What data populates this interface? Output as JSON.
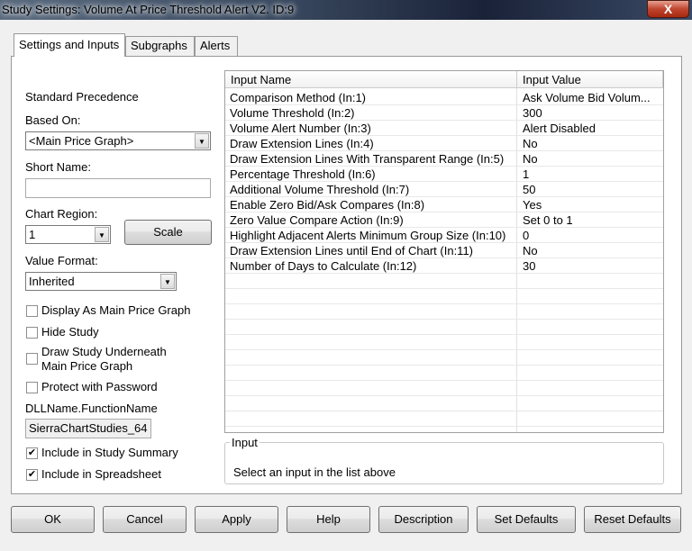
{
  "window": {
    "title": "Study Settings: Volume At Price Threshold Alert V2. ID:9",
    "close_label": "X"
  },
  "tabs": [
    {
      "label": "Settings and Inputs"
    },
    {
      "label": "Subgraphs"
    },
    {
      "label": "Alerts"
    }
  ],
  "left": {
    "standard_precedence": "Standard Precedence",
    "based_on_label": "Based On:",
    "based_on_value": "<Main Price Graph>",
    "short_name_label": "Short Name:",
    "short_name_value": "",
    "chart_region_label": "Chart Region:",
    "chart_region_value": "1",
    "scale_label": "Scale",
    "value_format_label": "Value Format:",
    "value_format_value": "Inherited",
    "checkboxes": [
      {
        "label": "Display As Main Price Graph",
        "checked": false
      },
      {
        "label": "Hide Study",
        "checked": false
      },
      {
        "label": "Draw Study Underneath Main Price Graph",
        "checked": false
      },
      {
        "label": "Protect with Password",
        "checked": false
      }
    ],
    "dll_label": "DLLName.FunctionName",
    "dll_value": "SierraChartStudies_64",
    "summary_label": "Include in Study Summary",
    "summary_checked": true,
    "spreadsheet_label": "Include in Spreadsheet",
    "spreadsheet_checked": true
  },
  "grid": {
    "headers": [
      "Input Name",
      "Input Value"
    ],
    "rows": [
      {
        "name": "Comparison Method   (In:1)",
        "value": "Ask Volume Bid Volum..."
      },
      {
        "name": "Volume Threshold   (In:2)",
        "value": "300"
      },
      {
        "name": "Volume Alert Number   (In:3)",
        "value": "Alert Disabled"
      },
      {
        "name": "Draw Extension Lines   (In:4)",
        "value": "No"
      },
      {
        "name": "Draw Extension Lines With Transparent Range   (In:5)",
        "value": "No"
      },
      {
        "name": "Percentage Threshold   (In:6)",
        "value": "1"
      },
      {
        "name": "Additional Volume Threshold   (In:7)",
        "value": "50"
      },
      {
        "name": "Enable Zero Bid/Ask Compares   (In:8)",
        "value": "Yes"
      },
      {
        "name": "Zero Value Compare Action   (In:9)",
        "value": "Set 0 to 1"
      },
      {
        "name": "Highlight Adjacent Alerts Minimum Group Size   (In:10)",
        "value": "0"
      },
      {
        "name": "Draw Extension Lines until End of Chart   (In:11)",
        "value": "No"
      },
      {
        "name": "Number of Days to Calculate   (In:12)",
        "value": "30"
      }
    ]
  },
  "input_group": {
    "label": "Input",
    "text": "Select an input in the list above"
  },
  "buttons": {
    "ok": "OK",
    "cancel": "Cancel",
    "apply": "Apply",
    "help": "Help",
    "description": "Description",
    "set_defaults": "Set Defaults",
    "reset_defaults": "Reset Defaults"
  }
}
